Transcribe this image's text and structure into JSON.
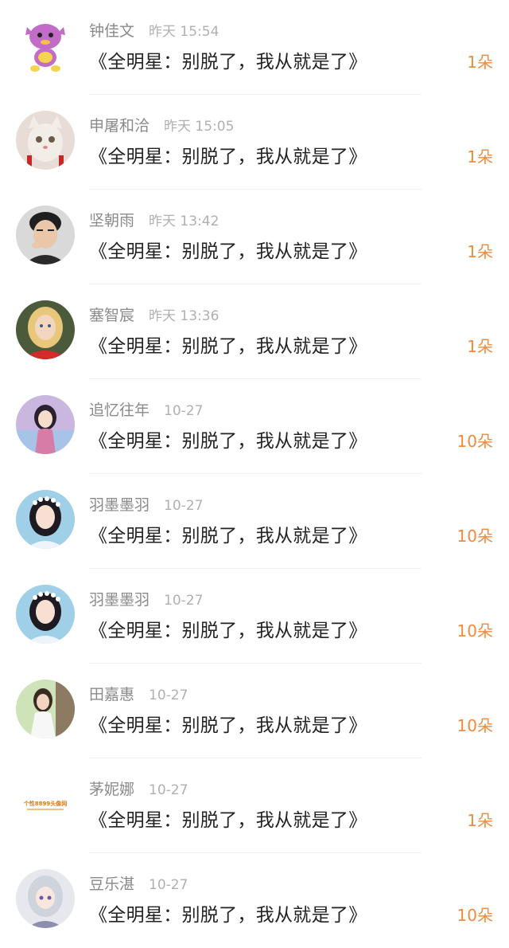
{
  "colors": {
    "accent": "#f08a3c",
    "name": "#8a8a8a",
    "time": "#b0b0b0",
    "title": "#222222"
  },
  "items": [
    {
      "name": "钟佳文",
      "time": "昨天 15:54",
      "title": "《全明星：别脱了，我从就是了》",
      "count": "1朵",
      "avatar_icon": "pink-creature-avatar"
    },
    {
      "name": "申屠和洽",
      "time": "昨天 15:05",
      "title": "《全明星：别脱了，我从就是了》",
      "count": "1朵",
      "avatar_icon": "cat-avatar"
    },
    {
      "name": "坚朝雨",
      "time": "昨天 13:42",
      "title": "《全明星：别脱了，我从就是了》",
      "count": "1朵",
      "avatar_icon": "man-avatar"
    },
    {
      "name": "塞智宸",
      "time": "昨天 13:36",
      "title": "《全明星：别脱了，我从就是了》",
      "count": "1朵",
      "avatar_icon": "girl-avatar"
    },
    {
      "name": "追忆往年",
      "time": "10-27",
      "title": "《全明星：别脱了，我从就是了》",
      "count": "10朵",
      "avatar_icon": "anime-girl-avatar"
    },
    {
      "name": "羽墨墨羽",
      "time": "10-27",
      "title": "《全明星：别脱了，我从就是了》",
      "count": "10朵",
      "avatar_icon": "flower-crown-girl-avatar"
    },
    {
      "name": "羽墨墨羽",
      "time": "10-27",
      "title": "《全明星：别脱了，我从就是了》",
      "count": "10朵",
      "avatar_icon": "flower-crown-girl-avatar"
    },
    {
      "name": "田嘉惠",
      "time": "10-27",
      "title": "《全明星：别脱了，我从就是了》",
      "count": "10朵",
      "avatar_icon": "woman-outdoor-avatar"
    },
    {
      "name": "茅妮娜",
      "time": "10-27",
      "title": "《全明星：别脱了，我从就是了》",
      "count": "1朵",
      "avatar_icon": "logo-avatar",
      "avatar_text": "个性8899头像网"
    },
    {
      "name": "豆乐湛",
      "time": "10-27",
      "title": "《全明星：别脱了，我从就是了》",
      "count": "10朵",
      "avatar_icon": "anime-silver-hair-avatar"
    }
  ]
}
